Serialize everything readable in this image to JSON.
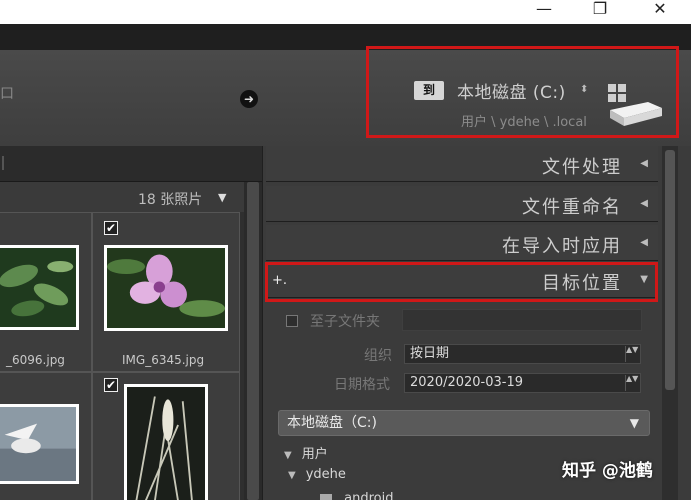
{
  "window": {
    "minimize_glyph": "—",
    "maximize_glyph": "❐",
    "close_glyph": "✕"
  },
  "header": {
    "to_badge": "到",
    "disk_name": "本地磁盘 (C:)",
    "disk_arrows": "⬍",
    "disk_path": "用户 \\ ydehe \\ .local",
    "arrow_glyph": "➜",
    "left_edge": "口"
  },
  "grid": {
    "photo_count": "18 张照片",
    "count_dropdown": "▼",
    "check_glyph": "✔",
    "files": [
      "_6096.jpg",
      "IMG_6345.jpg"
    ]
  },
  "panel": {
    "sections": [
      {
        "label": "文件处理",
        "arrow": "◀"
      },
      {
        "label": "文件重命名",
        "arrow": "◀"
      },
      {
        "label": "在导入时应用",
        "arrow": "◀"
      },
      {
        "label": "目标位置",
        "arrow": "▼"
      }
    ],
    "plus": "+.",
    "subfolder_label": "至子文件夹",
    "organize_label": "组织",
    "organize_value": "按日期",
    "date_format_label": "日期格式",
    "date_format_value": "2020/2020-03-19",
    "spin_glyph": "▲▼",
    "volume_select": "本地磁盘（C:)",
    "volume_dd": "▼",
    "tree": [
      {
        "label": "用户",
        "arrow": "▼"
      },
      {
        "label": "ydehe",
        "arrow": "▼"
      },
      {
        "label": ".android"
      }
    ]
  },
  "watermark": "知乎 @池鹤",
  "colors": {
    "highlight_border": "#d01818",
    "panel_bg": "#3b3b3b",
    "text_light": "#cdcdcd"
  }
}
